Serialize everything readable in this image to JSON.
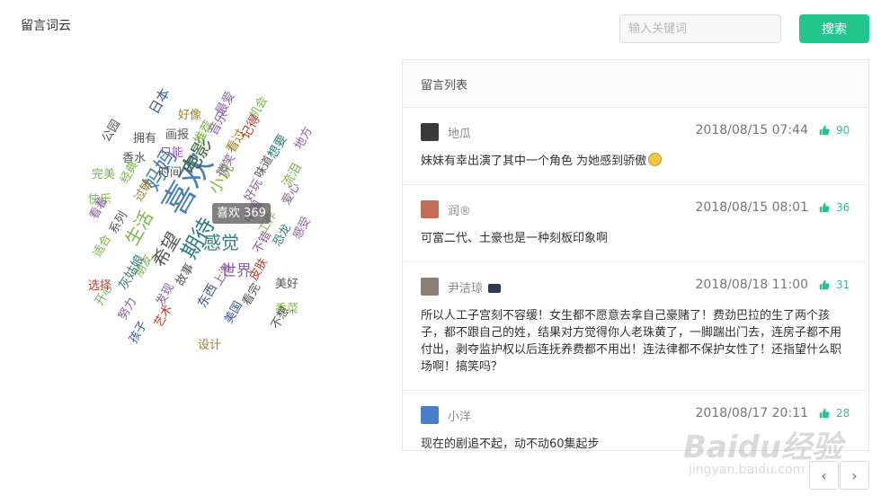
{
  "header": {
    "title": "留言词云",
    "search_placeholder": "输入关键词",
    "search_label": "搜索"
  },
  "cloud": {
    "tooltip": "喜欢 369",
    "words": [
      {
        "t": "喜欢",
        "c": "#4a7fb5"
      },
      {
        "t": "电影",
        "c": "#3e6b3e"
      },
      {
        "t": "妈妈",
        "c": "#4a7fb5"
      },
      {
        "t": "感觉",
        "c": "#2f7d7d"
      },
      {
        "t": "期待",
        "c": "#2f7d7d"
      },
      {
        "t": "希望",
        "c": "#555555"
      },
      {
        "t": "生活",
        "c": "#7ab648"
      },
      {
        "t": "世界",
        "c": "#8e5ea2"
      },
      {
        "t": "小说",
        "c": "#7ab648"
      },
      {
        "t": "日本",
        "c": "#3a5a9c"
      },
      {
        "t": "好像",
        "c": "#a07c2a"
      },
      {
        "t": "最爱",
        "c": "#8e5ea2"
      },
      {
        "t": "机会",
        "c": "#7ab648"
      },
      {
        "t": "画报",
        "c": "#555555"
      },
      {
        "t": "音乐",
        "c": "#8e5ea2"
      },
      {
        "t": "记得",
        "c": "#c0392b"
      },
      {
        "t": "地方",
        "c": "#8e5ea2"
      },
      {
        "t": "公园",
        "c": "#555555"
      },
      {
        "t": "拥有",
        "c": "#555555"
      },
      {
        "t": "只能",
        "c": "#8e5ea2"
      },
      {
        "t": "推荐",
        "c": "#7ab648"
      },
      {
        "t": "看过",
        "c": "#a07c2a"
      },
      {
        "t": "想要",
        "c": "#2f7d7d"
      },
      {
        "t": "香水",
        "c": "#555555"
      },
      {
        "t": "完美",
        "c": "#7ab648"
      },
      {
        "t": "时间",
        "c": "#555555"
      },
      {
        "t": "微笑",
        "c": "#8e5ea2"
      },
      {
        "t": "味道",
        "c": "#555555"
      },
      {
        "t": "流泪",
        "c": "#7ab648"
      },
      {
        "t": "经典",
        "c": "#7ab648"
      },
      {
        "t": "快乐",
        "c": "#7ab648"
      },
      {
        "t": "过敏",
        "c": "#a07c2a"
      },
      {
        "t": "好玩",
        "c": "#8e5ea2"
      },
      {
        "t": "爱心",
        "c": "#8e5ea2"
      },
      {
        "t": "看着",
        "c": "#8e5ea2"
      },
      {
        "t": "系列",
        "c": "#555555"
      },
      {
        "t": "中国",
        "c": "#8e5ea2"
      },
      {
        "t": "工作",
        "c": "#7ab648"
      },
      {
        "t": "恐龙",
        "c": "#2f7d7d"
      },
      {
        "t": "感受",
        "c": "#8e5ea2"
      },
      {
        "t": "适合",
        "c": "#7ab648"
      },
      {
        "t": "不错",
        "c": "#8e5ea2"
      },
      {
        "t": "美好",
        "c": "#555555"
      },
      {
        "t": "选择",
        "c": "#c0392b"
      },
      {
        "t": "朋友",
        "c": "#7ab648"
      },
      {
        "t": "故事",
        "c": "#555555"
      },
      {
        "t": "上海",
        "c": "#8e5ea2"
      },
      {
        "t": "皮肤",
        "c": "#c0392b"
      },
      {
        "t": "灰姑娘",
        "c": "#2f7d7d"
      },
      {
        "t": "开心",
        "c": "#7ab648"
      },
      {
        "t": "发现",
        "c": "#8e5ea2"
      },
      {
        "t": "东西",
        "c": "#3a5a9c"
      },
      {
        "t": "看完",
        "c": "#555555"
      },
      {
        "t": "香菜",
        "c": "#7ab648"
      },
      {
        "t": "努力",
        "c": "#8e5ea2"
      },
      {
        "t": "艺术",
        "c": "#c0392b"
      },
      {
        "t": "美国",
        "c": "#3a5a9c"
      },
      {
        "t": "不想",
        "c": "#555555"
      },
      {
        "t": "孩子",
        "c": "#3a5a9c"
      },
      {
        "t": "设计",
        "c": "#a07c2a"
      }
    ]
  },
  "comments_panel": {
    "title": "留言列表",
    "comments": [
      {
        "user": "地瓜",
        "time": "2018/08/15 07:44",
        "likes": "90",
        "text": "妹妹有幸出演了其中一个角色 为她感到骄傲",
        "avatar_color": "#3a3a3a",
        "has_emoji": true
      },
      {
        "user": "润®",
        "time": "2018/08/15 08:01",
        "likes": "36",
        "text": "可富二代、土豪也是一种刻板印象啊",
        "avatar_color": "#c56b5a",
        "has_emoji": false
      },
      {
        "user": "尹洁琼",
        "time": "2018/08/18 11:00",
        "likes": "31",
        "text": "所以人工子宫刻不容缓！女生都不愿意去拿自己豪赌了！费劲巴拉的生了两个孩子，都不跟自己的姓，结果对方觉得你人老珠黄了，一脚踹出门去，连房子都不用付出，剥夺监护权以后连抚养费都不用出！连法律都不保护女性了！还指望什么职场啊！搞笑吗？",
        "avatar_color": "#8a7f72",
        "has_emoji": false
      },
      {
        "user": "小洋",
        "time": "2018/08/17 20:11",
        "likes": "28",
        "text": "现在的剧追不起，动不动60集起步",
        "avatar_color": "#4a7fc9",
        "has_emoji": false
      }
    ]
  },
  "pagination": {
    "prev": "‹",
    "next": "›"
  },
  "watermark": {
    "logo": "Baidu经验",
    "url": "jingyan.baidu.com"
  },
  "colors": {
    "accent": "#22c68d"
  }
}
